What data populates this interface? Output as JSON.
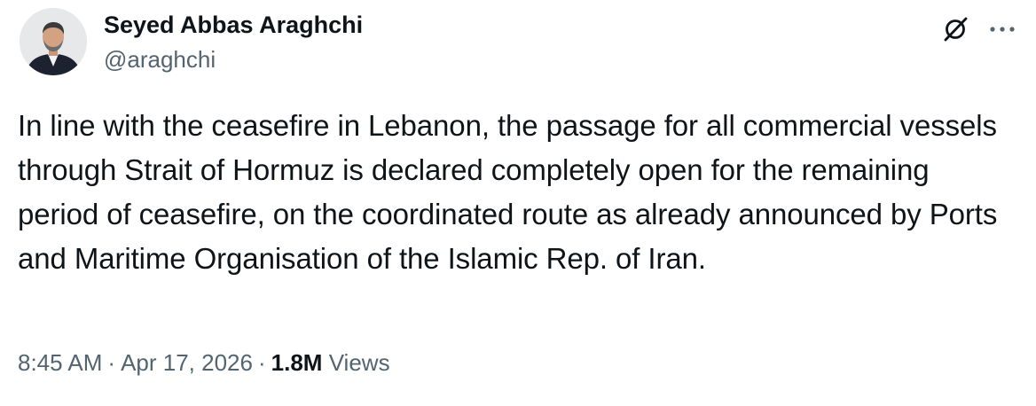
{
  "author": {
    "display_name": "Seyed Abbas Araghchi",
    "handle": "@araghchi"
  },
  "icons": {
    "avatar": "profile-photo",
    "grok": "grok-icon",
    "more": "more-icon"
  },
  "tweet": {
    "text": "In line with the ceasefire in Lebanon, the passage for all commercial vessels through Strait of Hormuz is declared completely open for the remaining period of ceasefire, on the coordinated route as already announced by Ports and Maritime Organisation of the Islamic Rep. of Iran.",
    "time": "8:45 AM",
    "date": "Apr 17, 2026",
    "views_count": "1.8M",
    "views_label": "Views",
    "separator": "·"
  },
  "colors": {
    "text_primary": "#0f1419",
    "text_secondary": "#536471",
    "background": "#ffffff"
  }
}
